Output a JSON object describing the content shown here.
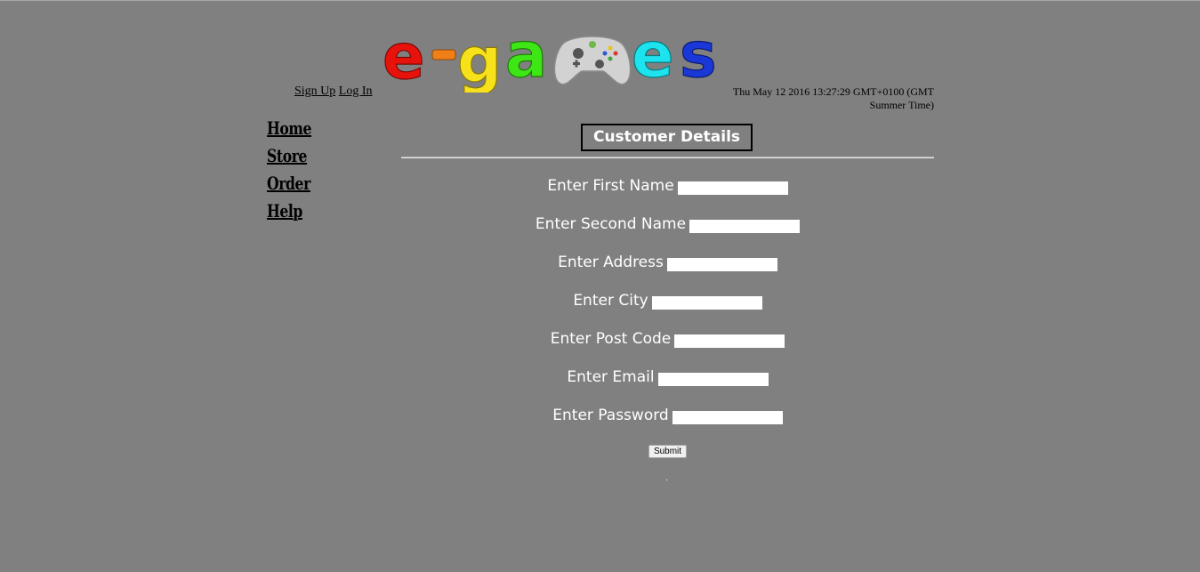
{
  "logo": {
    "letters": [
      "e",
      "-",
      "g",
      "a",
      "e",
      "s"
    ],
    "colors": {
      "e1": "#e8120c",
      "dash": "#f07f18",
      "g": "#f7e11a",
      "a": "#3fe615",
      "e2": "#1de3ee",
      "s": "#1a37d8",
      "controller": "#cfcfcf"
    },
    "icon": "game-controller-icon"
  },
  "auth": {
    "signup_label": "Sign Up",
    "login_label": "Log In"
  },
  "datetime": "Thu May 12 2016 13:27:29 GMT+0100 (GMT Summer Time)",
  "nav": {
    "items": [
      {
        "label": "Home"
      },
      {
        "label": "Store"
      },
      {
        "label": "Order"
      },
      {
        "label": "Help"
      }
    ]
  },
  "page": {
    "title": "Customer Details"
  },
  "form": {
    "fields": [
      {
        "label": "Enter First Name",
        "value": ""
      },
      {
        "label": "Enter Second Name",
        "value": ""
      },
      {
        "label": "Enter Address",
        "value": ""
      },
      {
        "label": "Enter City",
        "value": ""
      },
      {
        "label": "Enter Post Code",
        "value": ""
      },
      {
        "label": "Enter Email",
        "value": ""
      },
      {
        "label": "Enter Password",
        "value": ""
      }
    ],
    "submit_label": "Submit"
  },
  "colors": {
    "background": "#808080",
    "text_light": "#ffffff",
    "text_dark": "#000000"
  }
}
